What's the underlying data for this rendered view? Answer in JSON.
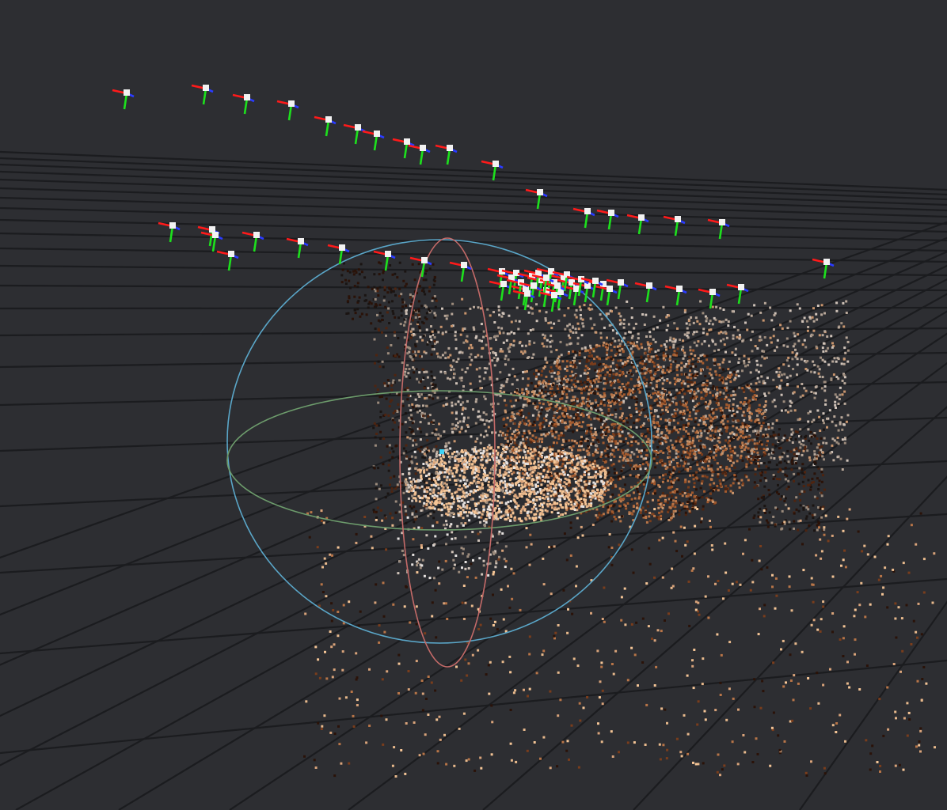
{
  "viewer": {
    "background_color": "#2d2e32",
    "grid": {
      "visible": true,
      "line_color": "#1b1c1f"
    },
    "trackball_gizmo": {
      "visible": true,
      "colors": {
        "x_axis": "#c46a68",
        "y_axis": "#6d9c6c",
        "z_axis": "#5aa6c8"
      },
      "pivot_color": "#3fd3f5"
    },
    "camera_frustum_markers": {
      "count": 60,
      "colors": {
        "x_axis": "#ff1a1a",
        "y_axis": "#1de01d",
        "z_axis": "#2a3bff",
        "body": "#f2f2f2"
      }
    },
    "point_cloud": {
      "visible": true,
      "palette": [
        "#f5c596",
        "#e8b98c",
        "#d9a37a",
        "#c9956d",
        "#b87548",
        "#a35a2e",
        "#7a3d1c",
        "#4e2410",
        "#2a1208",
        "#b9a89a",
        "#cfc2b8",
        "#9c8b7c",
        "#e6e2e0",
        "#1a1412"
      ]
    }
  }
}
